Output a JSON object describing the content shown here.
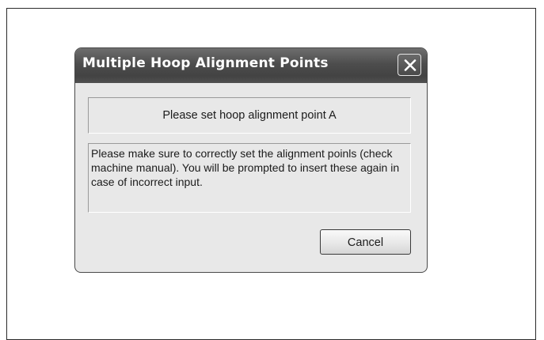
{
  "dialog": {
    "title": "Multiple Hoop Alignment Points",
    "close_icon": "close-x-icon",
    "prompt": "Please set hoop alignment point A",
    "info": "Please make sure to correctly set the alignment poinls (check machine manual).  You will be prompted to insert these again in case of incorrect input.",
    "cancel_label": "Cancel"
  }
}
